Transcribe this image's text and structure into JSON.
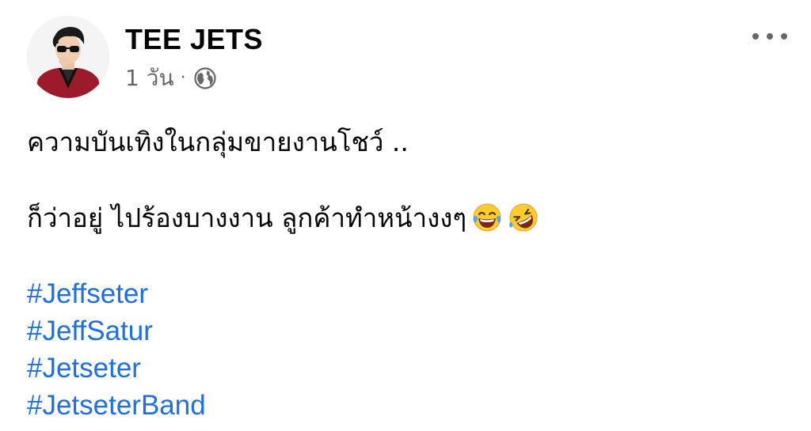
{
  "post": {
    "author": "TEE JETS",
    "timestamp": "1 วัน",
    "separator": "·",
    "privacy_icon": "globe-icon",
    "more_icon": "more-horizontal-icon",
    "avatar_icon": "profile-photo",
    "text_lines": [
      "ความบันเทิงในกลุ่มขายงานโชว์ ..",
      "ก็ว่าอยู่ ไปร้องบางงาน ลูกค้าทำหน้างงๆ"
    ],
    "emojis": [
      "face-with-tears-of-joy-emoji",
      "rolling-on-the-floor-laughing-emoji"
    ],
    "hashtags": [
      "#Jeffseter",
      "#JeffSatur",
      "#Jetseter",
      "#JetseterBand"
    ]
  },
  "colors": {
    "text": "#050505",
    "secondary": "#65676b",
    "link": "#216fdb",
    "background": "#ffffff"
  }
}
